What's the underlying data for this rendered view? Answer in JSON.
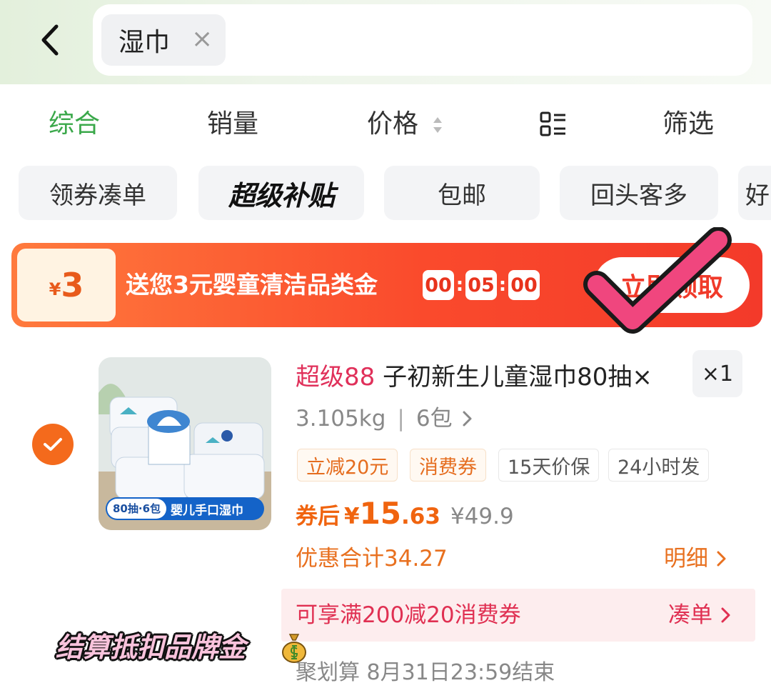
{
  "search": {
    "keyword": "湿巾"
  },
  "sort": {
    "comprehensive": "综合",
    "sales": "销量",
    "price": "价格",
    "filter": "筛选"
  },
  "filters": [
    "领券凑单",
    "超级补贴",
    "包邮",
    "回头客多",
    "好"
  ],
  "promo": {
    "coupon_amount": "3",
    "currency": "¥",
    "text": "送您3元婴童清洁品类金",
    "timer": [
      "00",
      "05",
      "00"
    ],
    "claim_label": "立即领取"
  },
  "product": {
    "brand_tag": "超级88",
    "title": "子初新生儿童湿巾80抽×",
    "quantity": "×1",
    "spec_weight": "3.105kg",
    "spec_pack": "6包",
    "image_badge_left": "80抽·6包",
    "image_badge_right": "婴儿手口湿巾",
    "tags": [
      "立减20元",
      "消费券",
      "15天价保",
      "24小时发"
    ],
    "price_label": "券后",
    "price_currency": "¥",
    "price_int": "15",
    "price_dec": ".63",
    "original_price": "¥49.9",
    "discount_total": "优惠合计34.27",
    "detail_label": "明细",
    "coupon_text": "可享满200减20消费券",
    "coupon_link": "凑单",
    "sticker_text": "结算抵扣品牌金",
    "deadline": "聚划算 8月31日23:59结束"
  },
  "colors": {
    "accent_green": "#3aa84a",
    "promo_red": "#f33a2a",
    "price_orange": "#f0640f",
    "brand_pink": "#e0305a",
    "select_orange": "#f46a1c"
  },
  "icons": {
    "back": "chevron-left-icon",
    "close": "close-icon",
    "sort": "sort-arrows-icon",
    "layout": "list-layout-icon",
    "check": "check-icon",
    "annotation": "pink-checkmark-icon",
    "money_bag": "money-bag-icon"
  }
}
